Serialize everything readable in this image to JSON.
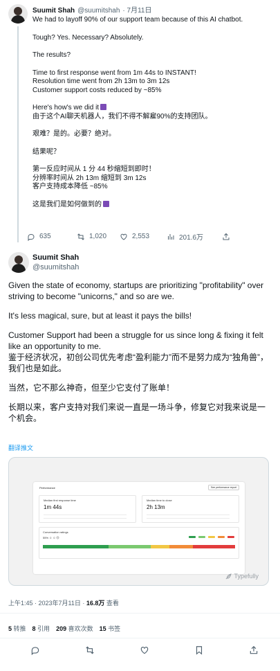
{
  "quoted": {
    "name": "Suumit Shah",
    "handle": "@suumitshah",
    "date": "· 7月11日",
    "lines_en": [
      "We had to layoff 90% of our support team because of this AI chatbot.",
      "Tough? Yes. Necessary? Absolutely.",
      "The results?",
      "Time to first response went from 1m 44s to INSTANT!",
      "Resolution time went from 2h 13m to 3m 12s",
      "Customer support costs reduced by ~85%",
      "Here's how's we did it"
    ],
    "lines_zh": [
      "由于这个AI聊天机器人，我们不得不解雇90%的支持团队。",
      "艰难？是的。必要？绝对。",
      "结果呢？",
      "第一反应时间从 1 分 44 秒缩短到即时！",
      "分辨率时间从 2h 13m 缩短到 3m 12s",
      "客户支持成本降低 ~85%",
      "这是我们是如何做到的"
    ],
    "stats": {
      "replies": "635",
      "retweets": "1,020",
      "likes": "2,553",
      "views": "201.6万"
    },
    "icons": [
      "reply-icon",
      "retweet-icon",
      "like-icon",
      "views-icon",
      "share-icon"
    ]
  },
  "main": {
    "name": "Suumit Shah",
    "handle": "@suumitshah",
    "paragraphs": [
      "Given the state of economy, startups are prioritizing \"profitability\" over striving to become \"unicorns,\" and so are we.",
      "It's less magical, sure, but at least it pays the bills!",
      "Customer Support had been a struggle for us since long & fixing it felt like an opportunity to me.",
      "鉴于经济状况，初创公司优先考虑“盈利能力”而不是努力成为“独角兽”，我们也是如此。",
      "当然，它不那么神奇，但至少它支付了账单！",
      "长期以来，客户支持对我们来说一直是一场斗争，修复它对我来说是一个机会。"
    ],
    "translate_label": "翻译推文",
    "media": {
      "dashboard_title": "Performance",
      "dashboard_button": "See performance report",
      "metric1_label": "Median first response time",
      "metric1_value": "1m 44s",
      "metric2_label": "Median time to close",
      "metric2_value": "2h 13m",
      "ratings_label": "Conversation ratings",
      "ratings_value": "55% ☺ ☺ ☹",
      "brand": "Typefully"
    },
    "meta": {
      "time": "上午1:45 · 2023年7月11日 · ",
      "views_count": "16.8万",
      "views_label": " 查看"
    },
    "stats": {
      "retweets_count": "5",
      "retweets_label": " 转推",
      "quotes_count": "8",
      "quotes_label": " 引用",
      "likes_count": "209",
      "likes_label": " 喜欢次数",
      "bookmarks_count": "15",
      "bookmarks_label": " 书签"
    },
    "icons": [
      "reply-icon",
      "retweet-icon",
      "like-icon",
      "bookmark-icon",
      "share-icon"
    ]
  },
  "colors": {
    "accent": "#1d9bf0",
    "text": "#0f1419",
    "muted": "#536471",
    "border": "#cfd9de"
  }
}
